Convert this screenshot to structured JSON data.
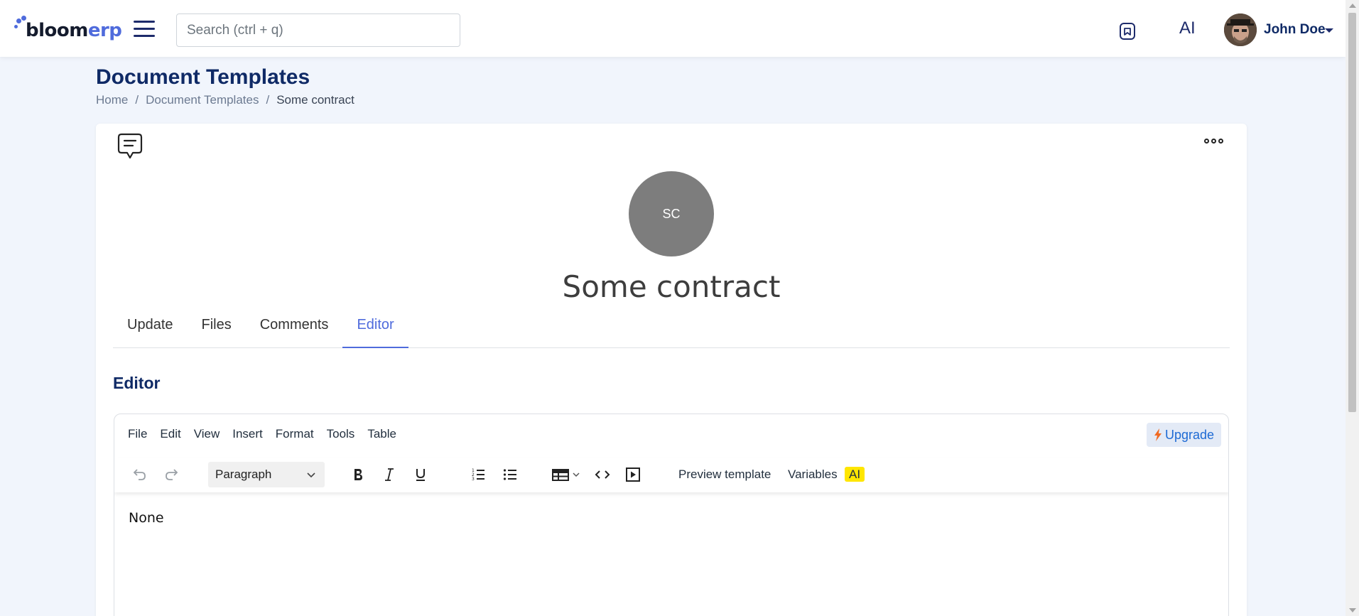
{
  "brand": {
    "logo_part1": "bloom",
    "logo_part2": "erp",
    "accent": "#4f6bdc",
    "navy": "#0f2a66"
  },
  "topbar": {
    "search_placeholder": "Search (ctrl + q)",
    "ai_label": "AI",
    "user_name": "John Doe"
  },
  "header": {
    "title": "Document Templates",
    "breadcrumb": [
      "Home",
      "Document Templates",
      "Some contract"
    ],
    "separator": "/"
  },
  "record": {
    "initials": "SC",
    "title": "Some contract"
  },
  "tabs": [
    {
      "label": "Update",
      "active": false
    },
    {
      "label": "Files",
      "active": false
    },
    {
      "label": "Comments",
      "active": false
    },
    {
      "label": "Editor",
      "active": true
    }
  ],
  "section_title": "Editor",
  "editor": {
    "menu": [
      "File",
      "Edit",
      "View",
      "Insert",
      "Format",
      "Tools",
      "Table"
    ],
    "upgrade_label": "Upgrade",
    "block_format": "Paragraph",
    "preview_label": "Preview template",
    "variables_label": "Variables",
    "ai_label": "AI",
    "content": "None"
  }
}
